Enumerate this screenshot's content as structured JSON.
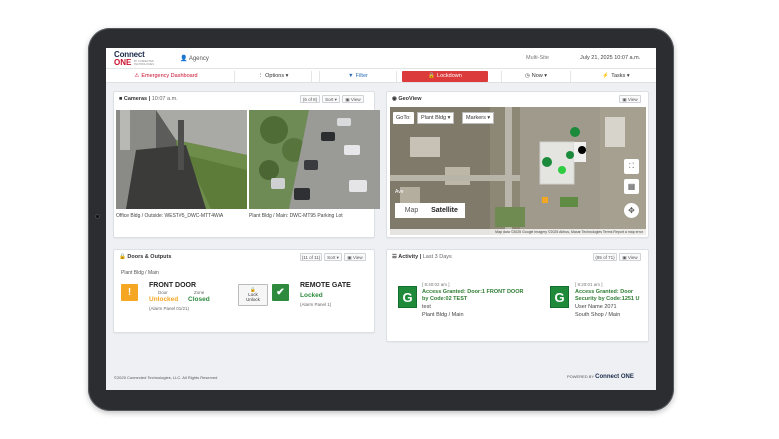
{
  "header": {
    "logo_line1": "Connect",
    "logo_line2a": "ONE",
    "logo_line2b": "®",
    "logo_tag": "BY CONNECTED TECHNOLOGIES",
    "agency": "Agency",
    "multisite": "Multi-Site",
    "datetime": "July 21, 2025 10:07 a.m."
  },
  "nav": {
    "emergency": "Emergency Dashboard",
    "options": "Options",
    "filter": "Filter",
    "lockdown": "Lockdown",
    "now": "Now",
    "tasks": "Tasks"
  },
  "cameras": {
    "title": "Cameras",
    "time": "10:07 a.m.",
    "count": "(6 of 8)",
    "sort": "Sort",
    "view": "View",
    "feeds": [
      {
        "caption": "Office Bldg / Outside: WEST#5_DWC-MTT4WiA"
      },
      {
        "caption": "Plant Bldg / Main: DWC-MT95 Parking Lot"
      }
    ]
  },
  "geoview": {
    "title": "GeoView",
    "view": "View",
    "goto_label": "GoTo:",
    "goto_value": "Plant Bldg",
    "markers": "Markers",
    "street": "Ave",
    "map_label": "Map",
    "satellite_label": "Satellite",
    "attribution": "Map data ©2025 Google Imagery ©2025 Airbus, Maxar Technologies   Terms   Report a map error"
  },
  "doors": {
    "title": "Doors & Outputs",
    "count": "(11 of 11)",
    "sort": "Sort",
    "view": "View",
    "site": "Plant Bldg / Main",
    "items": [
      {
        "name": "FRONT DOOR",
        "door_label": "Door",
        "zone_label": "Zone",
        "door_state": "Unlocked",
        "zone_state": "Closed",
        "panel": "(Alarm Panel 01/21)"
      },
      {
        "name": "REMOTE GATE",
        "door_state": "Locked",
        "panel": "(Alarm Panel 1)"
      }
    ],
    "lock_btn_line1": "Lock",
    "lock_btn_line2": "Unlock"
  },
  "activity": {
    "title": "Activity",
    "subtitle": "Last 3 Days",
    "count": "(85 of 71)",
    "view": "View",
    "items": [
      {
        "time": "[ 8:40:02 am ]",
        "icon": "G",
        "line1": "Access Granted: Door:1 FRONT DOOR",
        "line2": "by Code:02 TEST",
        "line3": "test",
        "line4": "Plant Bldg / Main"
      },
      {
        "time": "[ 8:20:01 am ]",
        "icon": "G",
        "line1": "Access Granted: Door",
        "line2": "Security by Code:1251 U",
        "line3": "User Name 2071",
        "line4": "South Shop / Main"
      }
    ]
  },
  "footer": {
    "left": "©2025 Connected Technologies, LLC. All Rights Reserved",
    "powered": "POWERED BY",
    "brand": "Connect ONE"
  },
  "colors": {
    "accent_red": "#dc3b3b",
    "link_blue": "#2a6fb5",
    "status_orange": "#f5a623",
    "status_green": "#2e8b3e"
  }
}
